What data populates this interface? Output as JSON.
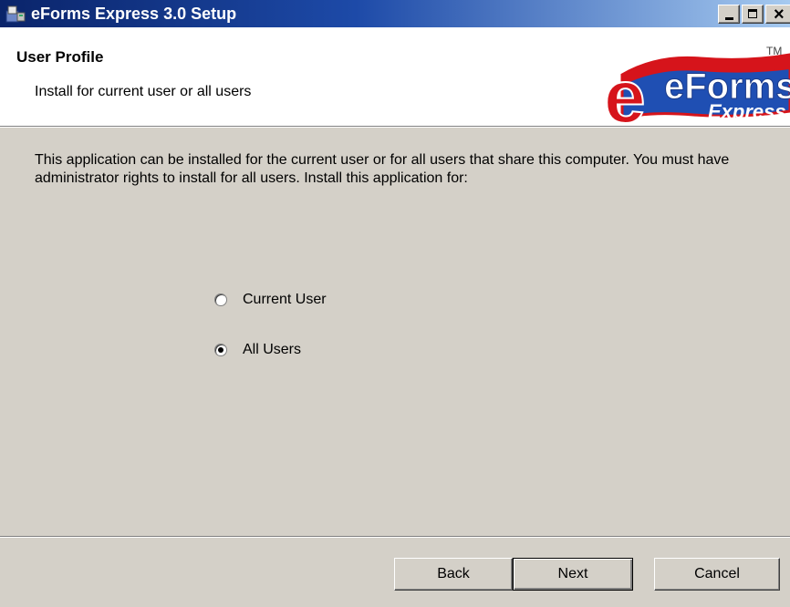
{
  "window": {
    "title": "eForms Express 3.0 Setup",
    "controls": {
      "minimize": "_",
      "maximize": "□",
      "close": "×"
    }
  },
  "header": {
    "title": "User Profile",
    "subtitle": "Install for current user or all users",
    "logo": {
      "main": "eForms",
      "sub": "Express",
      "tm": "TM"
    }
  },
  "body": {
    "description": "This application can be installed for the current user or for all users that share this computer. You must have administrator rights to install for all users. Install this application for:",
    "options": [
      {
        "label": "Current User",
        "selected": false
      },
      {
        "label": "All Users",
        "selected": true
      }
    ]
  },
  "buttons": {
    "back": "Back",
    "next": "Next",
    "cancel": "Cancel"
  },
  "colors": {
    "titlebar_start": "#0a246a",
    "titlebar_end": "#a6caf0",
    "dialog_bg": "#d4d0c8",
    "logo_red": "#d6141b",
    "logo_blue": "#1f4fb3"
  }
}
